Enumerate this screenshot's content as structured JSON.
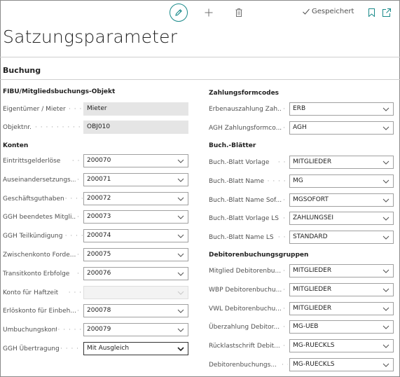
{
  "toolbar": {
    "edit_icon": "pencil-icon",
    "new_icon": "plus-icon",
    "delete_icon": "trash-icon",
    "saved_label": "Gespeichert",
    "bookmark_icon": "bookmark-icon",
    "open_new_window_icon": "open-in-new-window-icon"
  },
  "page": {
    "title": "Satzungsparameter",
    "section": "Buchung"
  },
  "left": {
    "group1": "FIBU/Mitgliedsbuchungs-Objekt",
    "owner_label": "Eigentümer / Mieter",
    "owner_value": "Mieter",
    "objnr_label": "Objektnr.",
    "objnr_value": "OBJ010",
    "group2": "Konten",
    "accounts": [
      {
        "label": "Eintrittsgelderlöse",
        "value": "200070"
      },
      {
        "label": "Auseinandersetzungs...",
        "value": "200071"
      },
      {
        "label": "Geschäftsguthaben",
        "value": "200072"
      },
      {
        "label": "GGH beendetes Mitgli...",
        "value": "200073"
      },
      {
        "label": "GGH Teilkündigung",
        "value": "200074"
      },
      {
        "label": "Zwischenkonto Forde...",
        "value": "200075"
      },
      {
        "label": "Transitkonto Erbfolge",
        "value": "200076"
      },
      {
        "label": "Konto für Haftzeit",
        "value": ""
      },
      {
        "label": "Erlöskonto für Einbeh...",
        "value": "200078"
      },
      {
        "label": "Umbuchungskonto",
        "value": "200079"
      }
    ],
    "ggh_label": "GGH Übertragung",
    "ggh_value": "Mit Ausgleich"
  },
  "right": {
    "group1": "Zahlungsformcodes",
    "payment": [
      {
        "label": "Erbenauszahlung Zah...",
        "value": "ERB"
      },
      {
        "label": "AGH Zahlungsformco...",
        "value": "AGH"
      }
    ],
    "group2": "Buch.-Blätter",
    "journals": [
      {
        "label": "Buch.-Blatt Vorlage",
        "value": "MITGLIEDER"
      },
      {
        "label": "Buch.-Blatt Name",
        "value": "MG"
      },
      {
        "label": "Buch.-Blatt Name Sof...",
        "value": "MGSOFORT"
      },
      {
        "label": "Buch.-Blatt Vorlage LS",
        "value": "ZAHLUNGSEI"
      },
      {
        "label": "Buch.-Blatt Name LS",
        "value": "STANDARD"
      }
    ],
    "group3": "Debitorenbuchungsgruppen",
    "debitor": [
      {
        "label": "Mitglied Debitorenbu...",
        "value": "MITGLIEDER"
      },
      {
        "label": "WBP Debitorenbuchu...",
        "value": "MITGLIEDER"
      },
      {
        "label": "VWL Debitorenbuchu...",
        "value": "MITGLIEDER"
      },
      {
        "label": "Überzahlung Debitor...",
        "value": "MG-UEB"
      },
      {
        "label": "Rücklastschrift Debit...",
        "value": "MG-RUECKLS"
      },
      {
        "label": "Debitorenbuchungs...",
        "value": "MG-RUECKLS"
      }
    ]
  },
  "colors": {
    "accent": "#1a8a8a",
    "field_readonly": "#e5e5e5"
  }
}
